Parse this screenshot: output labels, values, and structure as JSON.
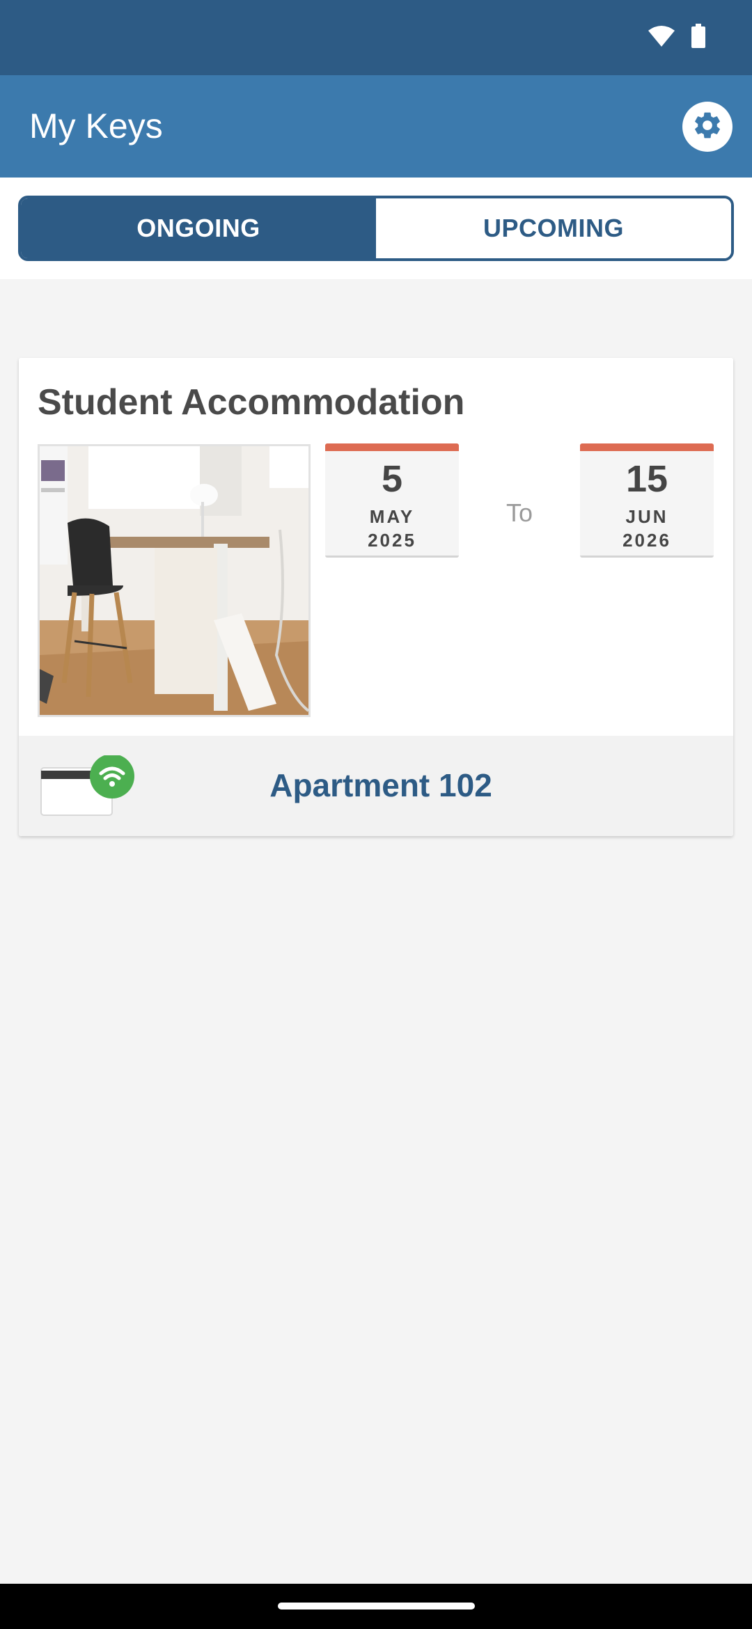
{
  "status_bar": {
    "icons": [
      "wifi-icon",
      "battery-icon"
    ],
    "color": "#2d5b85"
  },
  "app_bar": {
    "title": "My Keys",
    "settings_icon": "gear-icon",
    "color": "#3c7aad"
  },
  "tabs": [
    {
      "label": "ONGOING",
      "active": true
    },
    {
      "label": "UPCOMING",
      "active": false
    }
  ],
  "booking": {
    "title": "Student Accommodation",
    "photo": "room-photo",
    "start": {
      "day": "5",
      "month": "MAY",
      "year": "2025"
    },
    "separator": "To",
    "end": {
      "day": "15",
      "month": "JUN",
      "year": "2026"
    },
    "key": {
      "icon": "nfc-key-card-icon",
      "label": "Apartment 102"
    }
  },
  "colors": {
    "accent": "#2d5b85",
    "calendar_accent": "#dd6b52",
    "nfc_badge": "#4caf50"
  }
}
